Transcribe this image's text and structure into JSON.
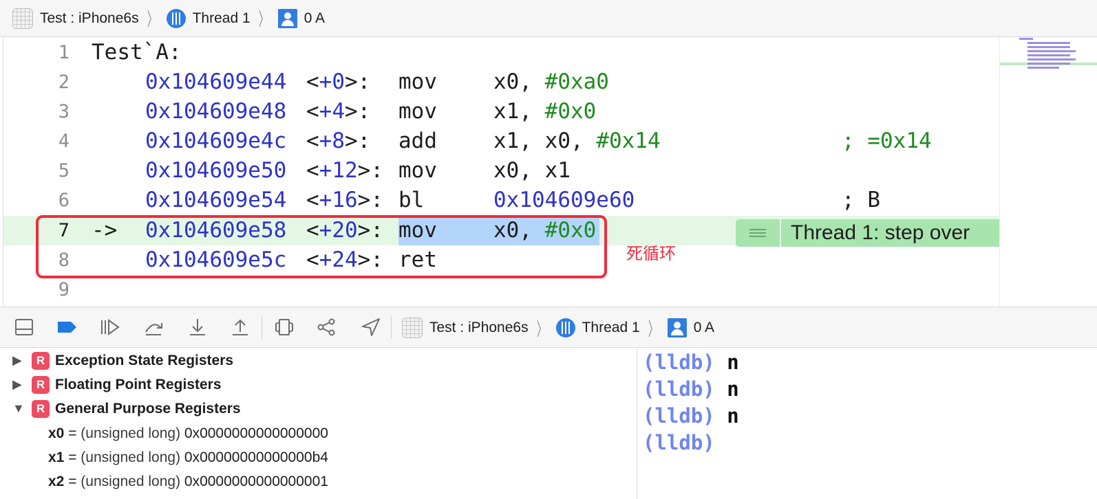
{
  "breadcrumb": {
    "app": "Test : iPhone6s",
    "thread": "Thread 1",
    "frame": "0 A"
  },
  "editor": {
    "lines": [
      {
        "num": "1",
        "label": "Test`A:"
      },
      {
        "num": "2",
        "addr": "0x104609e44",
        "off_open": "<",
        "off_num": "+0",
        "off_close": ">:",
        "op": "mov",
        "arg_pre": "x0, ",
        "arg_imm": "#0xa0"
      },
      {
        "num": "3",
        "addr": "0x104609e48",
        "off_open": "<",
        "off_num": "+4",
        "off_close": ">:",
        "op": "mov",
        "arg_pre": "x1, ",
        "arg_imm": "#0x0"
      },
      {
        "num": "4",
        "addr": "0x104609e4c",
        "off_open": "<",
        "off_num": "+8",
        "off_close": ">:",
        "op": "add",
        "arg_pre": "x1, x0, ",
        "arg_imm": "#0x14",
        "comment": "; =0x14"
      },
      {
        "num": "5",
        "addr": "0x104609e50",
        "off_open": "<",
        "off_num": "+12",
        "off_close": ">:",
        "op": "mov",
        "arg_pre": "x0, x1"
      },
      {
        "num": "6",
        "addr": "0x104609e54",
        "off_open": "<",
        "off_num": "+16",
        "off_close": ">:",
        "op": "bl",
        "arg_addr": "0x104609e60",
        "comment": "; B"
      },
      {
        "num": "7",
        "arrow": "->",
        "addr": "0x104609e58",
        "off_open": "<",
        "off_num": "+20",
        "off_close": ">:",
        "op": "mov",
        "arg_pre": "x0, ",
        "arg_imm": "#0x0"
      },
      {
        "num": "8",
        "addr": "0x104609e5c",
        "off_open": "<",
        "off_num": "+24",
        "off_close": ">:",
        "op": "ret"
      },
      {
        "num": "9"
      }
    ],
    "annotation": "Thread 1: step over",
    "overlay_note": "死循环"
  },
  "variables": {
    "groups": [
      {
        "title": "Exception State Registers",
        "badge": "R"
      },
      {
        "title": "Floating Point Registers",
        "badge": "R"
      },
      {
        "title": "General Purpose Registers",
        "badge": "R"
      }
    ],
    "registers": [
      {
        "name": "x0",
        "eq": " = ",
        "type": "(unsigned long)",
        "value": " 0x0000000000000000"
      },
      {
        "name": "x1",
        "eq": " = ",
        "type": "(unsigned long)",
        "value": " 0x00000000000000b4"
      },
      {
        "name": "x2",
        "eq": " = ",
        "type": "(unsigned long)",
        "value": " 0x0000000000000001"
      }
    ]
  },
  "console": {
    "lines": [
      {
        "prompt": "(lldb)",
        "cmd": " n"
      },
      {
        "prompt": "(lldb)",
        "cmd": " n"
      },
      {
        "prompt": "(lldb)",
        "cmd": " n"
      },
      {
        "prompt": "(lldb)",
        "cmd": ""
      }
    ]
  },
  "colors": {
    "address": "#2d33c8",
    "immediate": "#1e8b1e",
    "current_line": "#e4f7e4",
    "annotation": "#a8e4ad",
    "selection": "#b4d5fb",
    "red_box": "#f02c3e",
    "prompt": "#6f86ef",
    "register_badge": "#ee4c63"
  },
  "icons": [
    "app-grid-icon",
    "thread-icon",
    "stack-frame-icon",
    "toggle-console-icon",
    "breakpoints-icon",
    "continue-icon",
    "step-over-icon",
    "step-into-icon",
    "step-out-icon",
    "view-debugger-icon",
    "memory-graph-icon",
    "simulate-location-icon"
  ]
}
